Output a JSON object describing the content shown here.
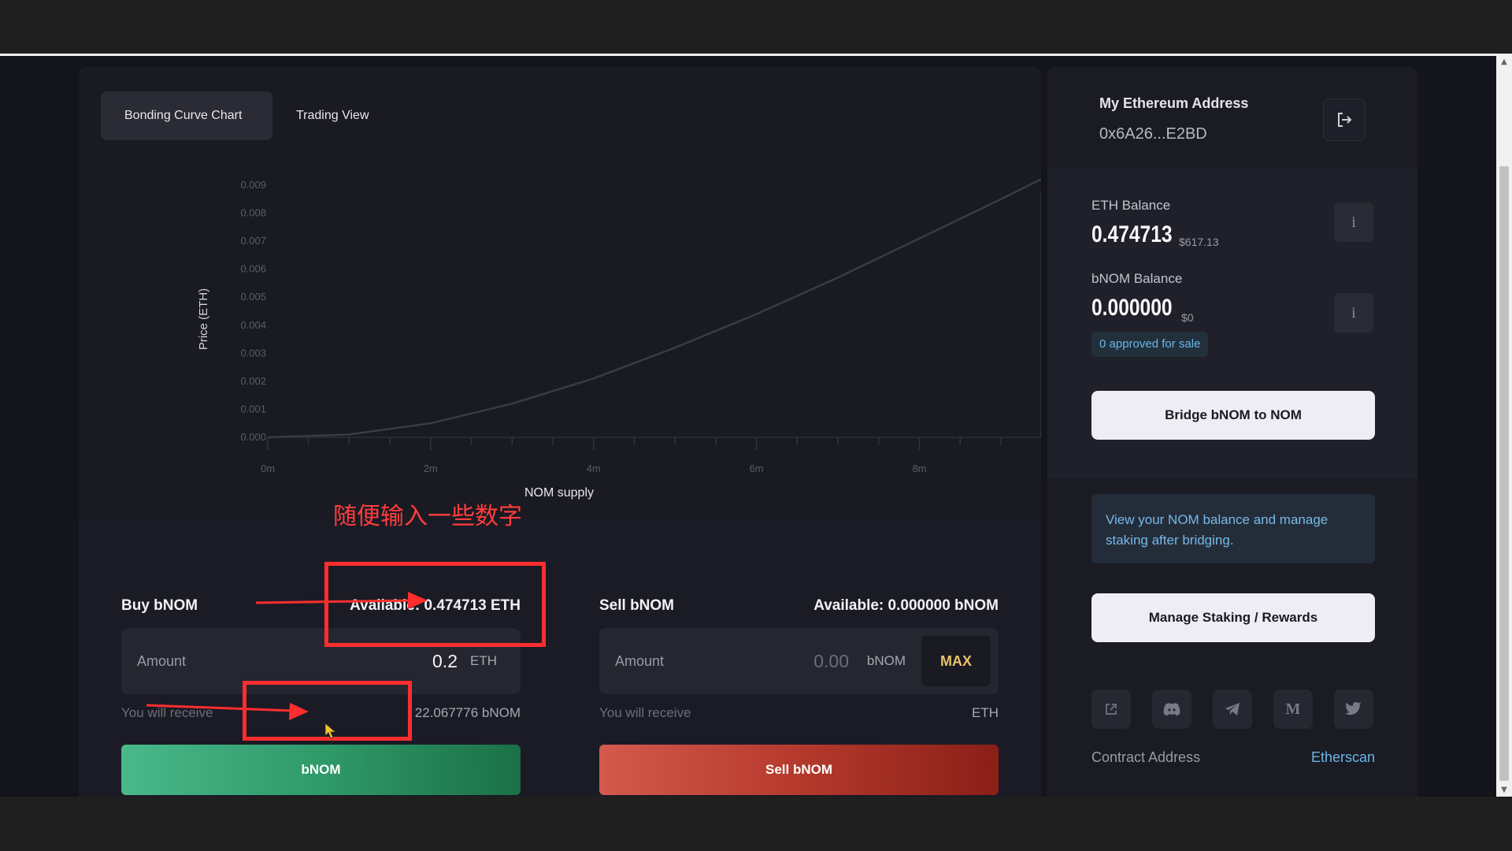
{
  "chart": {
    "tabs": [
      {
        "label": "Bonding Curve Chart",
        "active": true
      },
      {
        "label": "Trading View",
        "active": false
      }
    ]
  },
  "chart_data": {
    "type": "line",
    "xlabel": "NOM supply",
    "ylabel": "Price (ETH)",
    "x_ticks": [
      "0m",
      "2m",
      "4m",
      "6m",
      "8m"
    ],
    "y_ticks": [
      "0.000",
      "0.001",
      "0.002",
      "0.003",
      "0.004",
      "0.005",
      "0.006",
      "0.007",
      "0.008",
      "0.009"
    ],
    "xlim": [
      0,
      9.9
    ],
    "ylim": [
      0,
      0.009
    ],
    "series": [
      {
        "x": [
          0,
          1,
          2,
          3,
          4,
          5,
          6,
          7,
          8,
          9,
          9.9
        ],
        "y": [
          0,
          0.0001,
          0.0005,
          0.0012,
          0.0021,
          0.0032,
          0.0044,
          0.0057,
          0.0071,
          0.0085,
          0.0098
        ]
      }
    ],
    "marker_x": 9.5,
    "grid": false,
    "colors": {
      "line": "#3a3a48",
      "marker": "#4e5f7a"
    }
  },
  "buy": {
    "label": "Buy bNOM",
    "available": "Available: 0.474713 ETH",
    "placeholder": "Amount",
    "value": "0.2",
    "unit": "ETH",
    "receive_label": "You will receive",
    "receive_value": "22.067776 bNOM",
    "button_label": "bNOM"
  },
  "sell": {
    "label": "Sell bNOM",
    "available": "Available: 0.000000 bNOM",
    "placeholder": "Amount",
    "value": "0.00",
    "unit": "bNOM",
    "max_label": "MAX",
    "receive_label": "You will receive",
    "receive_value": "ETH",
    "button_label": "Sell bNOM"
  },
  "account": {
    "title": "My Ethereum Address",
    "address": "0x6A26...E2BD",
    "eth_label": "ETH Balance",
    "eth_value": "0.474713",
    "eth_usd": "$617.13",
    "bnom_label": "bNOM Balance",
    "bnom_value": "0.000000",
    "bnom_usd": "$0",
    "approved": "0 approved for sale",
    "bridge_button": "Bridge bNOM to NOM",
    "info_text": "View your NOM balance and manage staking after bridging.",
    "staking_button": "Manage Staking / Rewards",
    "contract_label": "Contract Address",
    "etherscan_link": "Etherscan",
    "info_icon": "i",
    "medium_icon": "M"
  },
  "annotation": {
    "text": "随便输入一些数字",
    "color": "#ff2e2e"
  }
}
